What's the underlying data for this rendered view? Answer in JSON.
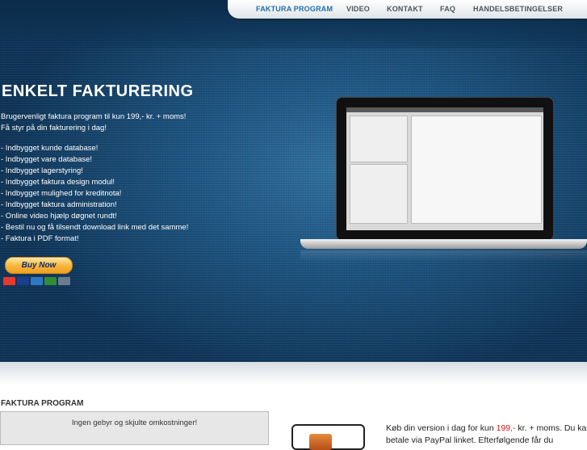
{
  "nav": {
    "items": [
      {
        "label": "FAKTURA PROGRAM",
        "active": true
      },
      {
        "label": "VIDEO",
        "active": false
      },
      {
        "label": "KONTAKT",
        "active": false
      },
      {
        "label": "FAQ",
        "active": false
      },
      {
        "label": "HANDELSBETINGELSER",
        "active": false
      }
    ]
  },
  "hero": {
    "title": "ENKELT FAKTURERING",
    "intro": [
      "Brugervenligt faktura program til kun 199,- kr. + moms!",
      "Få styr på din fakturering i dag!"
    ],
    "features": [
      "- Indbygget kunde database!",
      "- Indbygget vare database!",
      "- Indbygget lagerstyring!",
      "- Indbygget faktura design modul!",
      "- Indbygget mulighed for kreditnota!",
      "- Indbygget faktura administration!",
      "- Online video hjælp døgnet rundt!",
      "- Bestil nu og få tilsendt download link med det samme!",
      "- Faktura i PDF format!"
    ],
    "buy_label": "Buy Now",
    "cards": [
      {
        "name": "mastercard-icon",
        "color": "#e8382b"
      },
      {
        "name": "visa-icon",
        "color": "#1a3f8f"
      },
      {
        "name": "amex-icon",
        "color": "#2b79c2"
      },
      {
        "name": "jcb-icon",
        "color": "#2f8d3a"
      },
      {
        "name": "bank-icon",
        "color": "#6b7c90"
      }
    ]
  },
  "section": {
    "title": "FAKTURA PROGRAM",
    "promo_text": "Ingen gebyr og skjulte omkostninger!",
    "body_prefix": "Køb din version i dag for kun ",
    "price": "199,-",
    "body_suffix": " kr. + moms. Du kan betale via PayPal linket. Efterfølgende får du"
  },
  "colors": {
    "accent": "#1f6fb0",
    "price": "#d01717",
    "hero_blue": "#1d5480"
  }
}
